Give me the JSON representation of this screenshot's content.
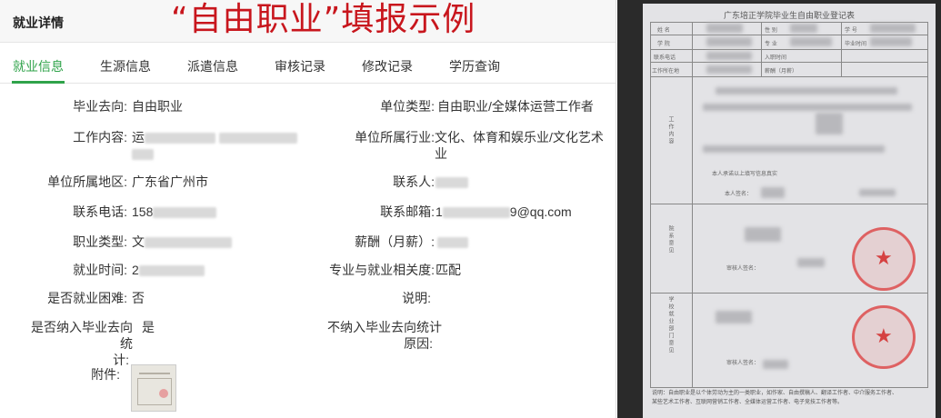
{
  "header": {
    "title": "就业详情",
    "banner": "“自由职业”填报示例"
  },
  "tabs": [
    {
      "label": "就业信息",
      "active": true
    },
    {
      "label": "生源信息"
    },
    {
      "label": "派遣信息"
    },
    {
      "label": "审核记录"
    },
    {
      "label": "修改记录"
    },
    {
      "label": "学历查询"
    }
  ],
  "fields": {
    "destination": {
      "label": "毕业去向:",
      "value": "自由职业"
    },
    "unit_type": {
      "label": "单位类型:",
      "value": "自由职业/全媒体运营工作者"
    },
    "job_content": {
      "label": "工作内容:",
      "value": "运"
    },
    "industry": {
      "label": "单位所属行业:",
      "value": "文化、体育和娱乐业/文化艺术业"
    },
    "region": {
      "label": "单位所属地区:",
      "value": "广东省广州市"
    },
    "contact": {
      "label": "联系人:",
      "value": ""
    },
    "phone": {
      "label": "联系电话:",
      "value": "158"
    },
    "email": {
      "label": "联系邮箱:",
      "value_prefix": "1",
      "value_suffix": "9@qq.com"
    },
    "job_type": {
      "label": "职业类型:",
      "value": "文"
    },
    "salary": {
      "label": "薪酬（月薪）:",
      "value": ""
    },
    "employment_time": {
      "label": "就业时间:",
      "value": "2"
    },
    "relevance": {
      "label": "专业与就业相关度:",
      "value": "匹配"
    },
    "difficulty": {
      "label": "是否就业困难:",
      "value": "否"
    },
    "note": {
      "label": "说明:",
      "value": ""
    },
    "included": {
      "label_line1": "是否纳入毕业去向统",
      "label_line2": "计:",
      "value": "是"
    },
    "excluded_reason": {
      "label_line1": "不纳入毕业去向统计",
      "label_line2": "原因:",
      "value": ""
    },
    "attachment": {
      "label": "附件:"
    }
  },
  "form": {
    "title": "广东培正学院毕业生自由职业登记表",
    "row1": [
      "姓 名",
      "性 别",
      "学 号"
    ],
    "row2": [
      "学 院",
      "专 业",
      "毕业时间"
    ],
    "row3": [
      "联系电话",
      "入职时间"
    ],
    "row4": [
      "工作所在地",
      "薪酬（月薪）"
    ],
    "work_content": "工作内容",
    "promise": "本人承诺以上填写信息真实",
    "sign": "本人签名：",
    "college_opinion": "院系意见",
    "reviewer_sign": "审核人签名：",
    "school_opinion": "学校就业部门意见",
    "reviewer_sign2": "审核人签名：",
    "footnote_line1": "说明：自由职业是以个体劳动为主的一类职业，如作家、自由撰稿人、翻译工作者、中介服务工作者、",
    "footnote_line2": "某些艺术工作者、互联网营销工作者、全媒体运营工作者、电子竞技工作者等。"
  },
  "colors": {
    "accent": "#2fa34a",
    "banner": "#c8161d",
    "seal": "#dc3c3c"
  }
}
